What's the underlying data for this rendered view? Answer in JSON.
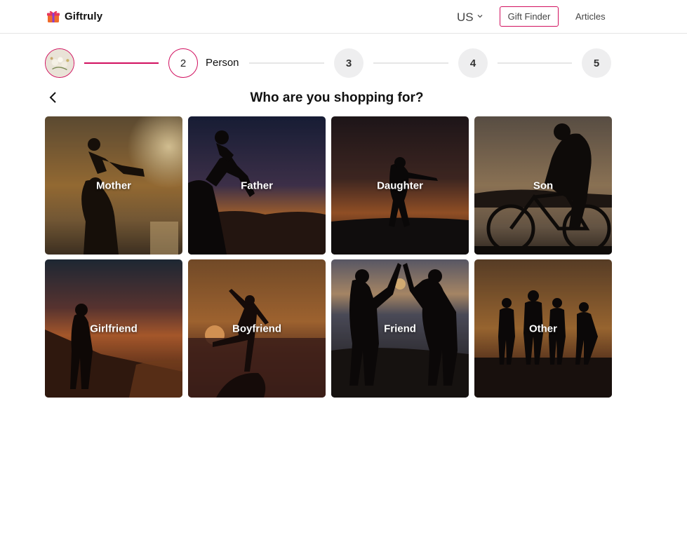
{
  "header": {
    "brand": "Giftruly",
    "region": "US",
    "gift_finder_label": "Gift Finder",
    "articles_label": "Articles"
  },
  "stepper": {
    "steps": [
      {
        "label": "",
        "state": "done"
      },
      {
        "label": "2",
        "state": "active",
        "caption": "Person"
      },
      {
        "label": "3",
        "state": "pending"
      },
      {
        "label": "4",
        "state": "pending"
      },
      {
        "label": "5",
        "state": "pending"
      }
    ]
  },
  "page": {
    "title": "Who are you shopping for?"
  },
  "options": [
    {
      "label": "Mother",
      "scene": "mother"
    },
    {
      "label": "Father",
      "scene": "father"
    },
    {
      "label": "Daughter",
      "scene": "daughter"
    },
    {
      "label": "Son",
      "scene": "son"
    },
    {
      "label": "Girlfriend",
      "scene": "girlfriend"
    },
    {
      "label": "Boyfriend",
      "scene": "boyfriend"
    },
    {
      "label": "Friend",
      "scene": "friend"
    },
    {
      "label": "Other",
      "scene": "other"
    }
  ],
  "colors": {
    "accent": "#d1105f",
    "pending_step_bg": "#eeeeef",
    "text": "#111111"
  }
}
